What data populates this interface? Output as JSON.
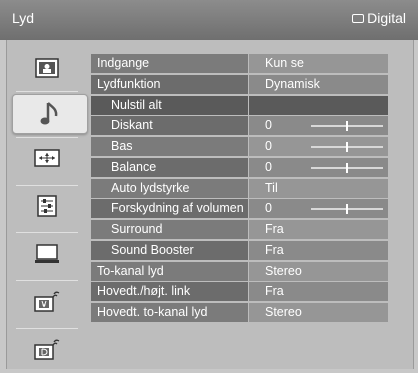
{
  "header": {
    "title": "Lyd",
    "input_label": "Digital"
  },
  "sidebar": {
    "items": [
      {
        "icon": "picture-icon",
        "active": false
      },
      {
        "icon": "music-note-icon",
        "active": true
      },
      {
        "icon": "screen-icon",
        "active": false
      },
      {
        "icon": "setup-icon",
        "active": false
      },
      {
        "icon": "pc-icon",
        "active": false
      },
      {
        "icon": "analog-channel-icon",
        "active": false
      },
      {
        "icon": "digital-channel-icon",
        "active": false
      }
    ]
  },
  "menu": {
    "rows": [
      {
        "label": "Indgange",
        "value": "Kun se",
        "indent": 0,
        "slider": null
      },
      {
        "label": "Lydfunktion",
        "value": "Dynamisk",
        "indent": 0,
        "slider": null
      },
      {
        "label": "Nulstil alt",
        "value": "",
        "indent": 1,
        "slider": null,
        "selected": true
      },
      {
        "label": "Diskant",
        "value": "0",
        "indent": 1,
        "slider": 0.5
      },
      {
        "label": "Bas",
        "value": "0",
        "indent": 1,
        "slider": 0.5
      },
      {
        "label": "Balance",
        "value": "0",
        "indent": 1,
        "slider": 0.5
      },
      {
        "label": "Auto lydstyrke",
        "value": "Til",
        "indent": 1,
        "slider": null
      },
      {
        "label": "Forskydning af volumen",
        "value": "0",
        "indent": 1,
        "slider": 0.5
      },
      {
        "label": "Surround",
        "value": "Fra",
        "indent": 1,
        "slider": null
      },
      {
        "label": "Sound Booster",
        "value": "Fra",
        "indent": 1,
        "slider": null
      },
      {
        "label": "To-kanal lyd",
        "value": "Stereo",
        "indent": 0,
        "slider": null
      },
      {
        "label": "Hovedt./højt. link",
        "value": "Fra",
        "indent": 0,
        "slider": null
      },
      {
        "label": "Hovedt. to-kanal lyd",
        "value": "Stereo",
        "indent": 0,
        "slider": null
      }
    ]
  }
}
